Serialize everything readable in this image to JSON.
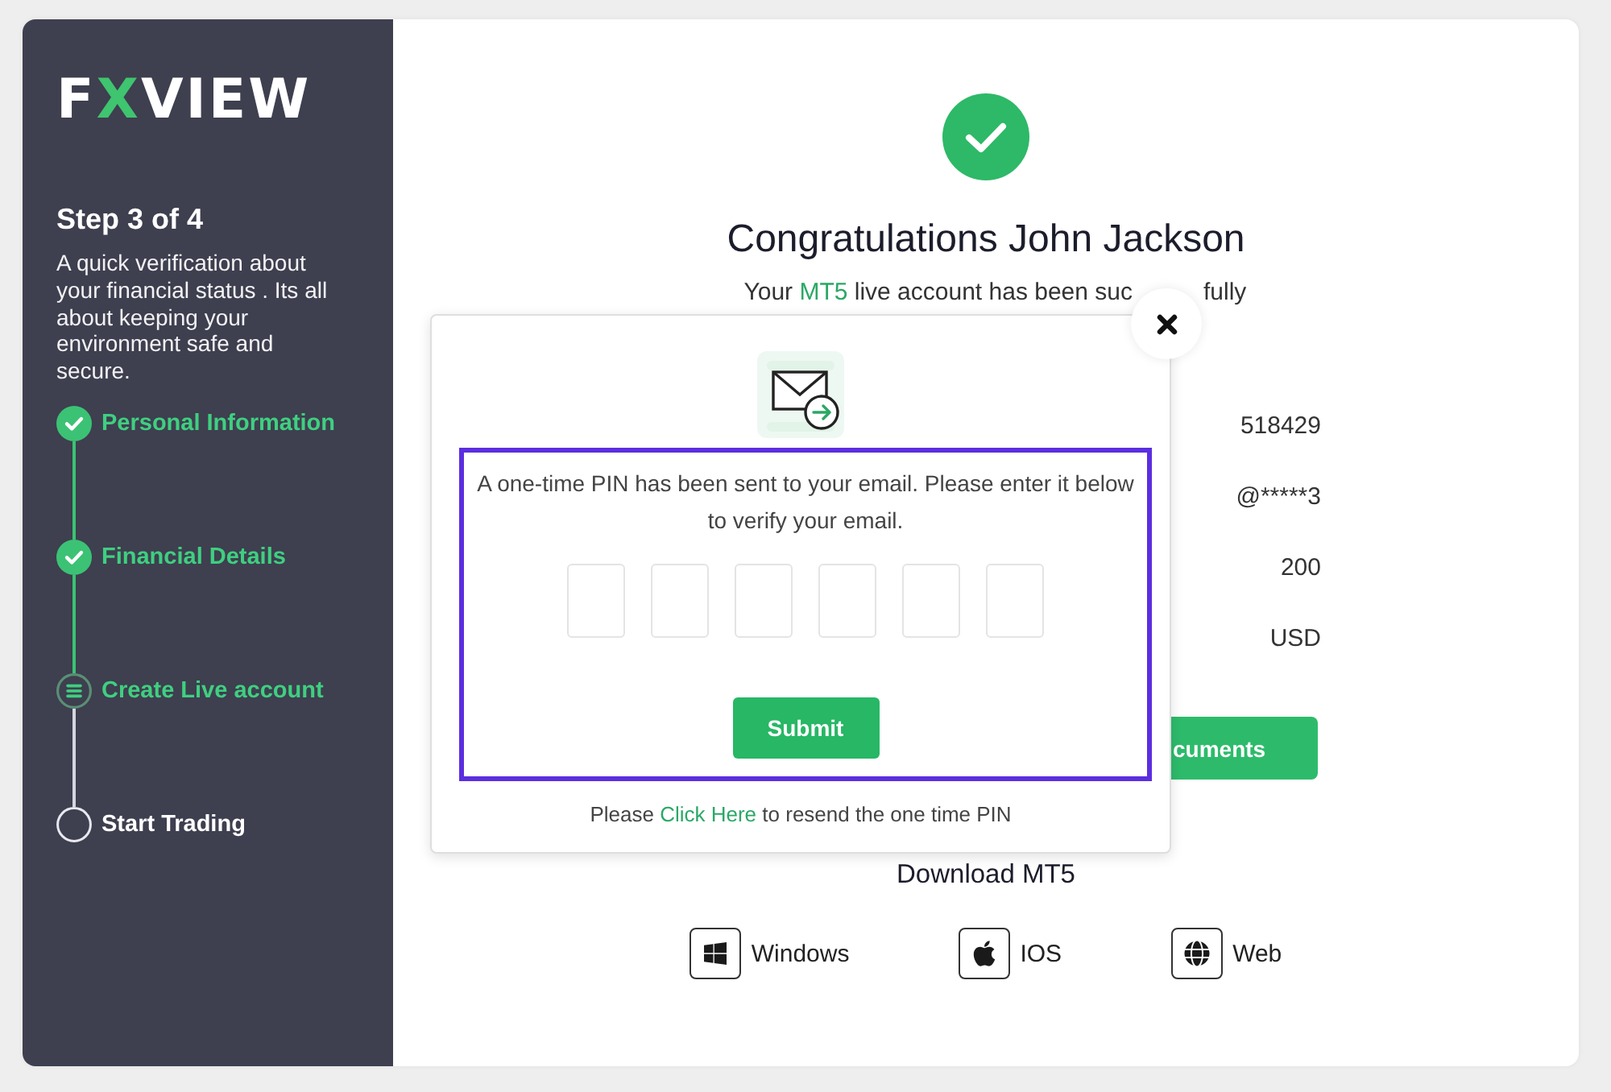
{
  "sidebar": {
    "logo": {
      "start": "F",
      "accent": "X",
      "end": "VIEW"
    },
    "step_title": "Step 3 of 4",
    "description": "A quick verification about your financial status . Its all about keeping your environment safe and secure.",
    "steps": [
      {
        "label": "Personal Information",
        "kind": "done"
      },
      {
        "label": "Financial Details",
        "kind": "done"
      },
      {
        "label": "Create Live account",
        "kind": "current"
      },
      {
        "label": "Start Trading",
        "kind": "pending"
      }
    ]
  },
  "main": {
    "title": "Congratulations John Jackson",
    "subtitle": {
      "before": "Your",
      "highlight": "MT5",
      "after": "live account has been suc",
      "tail": "fully"
    },
    "account_details": [
      {
        "value": "518429"
      },
      {
        "value": "@*****3"
      },
      {
        "value": "200"
      },
      {
        "value": "USD"
      }
    ],
    "documents_button": {
      "label": "cuments"
    },
    "download": {
      "title": "Download MT5",
      "platforms": [
        {
          "kind": "windows",
          "label": "Windows"
        },
        {
          "kind": "apple",
          "label": "IOS"
        },
        {
          "kind": "globe",
          "label": "Web"
        }
      ]
    }
  },
  "otp_modal": {
    "highlighted": true,
    "message": "A one-time PIN has been sent to your email. Please enter it below to verify your email.",
    "pin_boxes": [
      {
        "filled": false
      },
      {
        "filled": false
      },
      {
        "filled": false
      },
      {
        "filled": false
      },
      {
        "filled": false
      },
      {
        "filled": false
      }
    ],
    "submit_label": "Submit",
    "resend": {
      "before": "Please",
      "link": "Click Here",
      "after": "to resend the one time PIN"
    }
  }
}
